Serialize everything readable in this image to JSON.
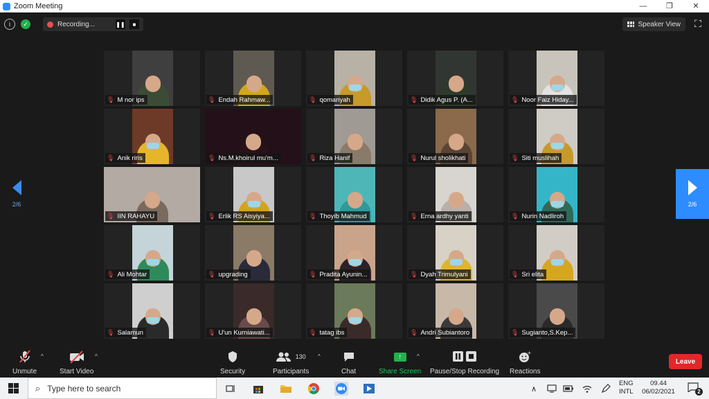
{
  "window": {
    "title": "Zoom Meeting",
    "minimize_glyph": "—",
    "restore_glyph": "❐",
    "close_glyph": "✕"
  },
  "topbar": {
    "info_glyph": "i",
    "shield_glyph": "✓",
    "recording_label": "Recording...",
    "pause_glyph": "❚❚",
    "stop_glyph": "■",
    "speaker_view_label": "Speaker View",
    "fullscreen_glyph": "⛶"
  },
  "pager": {
    "prev_label": "2/6",
    "next_label": "2/6"
  },
  "participants": [
    {
      "name": "M nor ips",
      "bg": "#3f3f3f",
      "shirt": "#3c4b36",
      "mask": false
    },
    {
      "name": "Endah Rahmaw...",
      "bg": "#5e5a52",
      "shirt": "#d4a71a",
      "mask": false
    },
    {
      "name": "qomariyah",
      "bg": "#b8b2a6",
      "shirt": "#c89a2a",
      "mask": true
    },
    {
      "name": "Didik Agus P. (A...",
      "bg": "#323632",
      "shirt": "#2e3b2b",
      "mask": false
    },
    {
      "name": "Noor Faiz Hiday...",
      "bg": "#c8c4bc",
      "shirt": "#e2e2e2",
      "mask": true
    },
    {
      "name": "Anik riris",
      "bg": "#6e3a28",
      "shirt": "#e5b62a",
      "mask": true
    },
    {
      "name": "Ns.M.khoirul mu'm...",
      "bg": "#241018",
      "shirt": "#2a1218",
      "mask": false
    },
    {
      "name": "Riza Hanif",
      "bg": "#a09a94",
      "shirt": "#8a7a6a",
      "mask": false
    },
    {
      "name": "Nurul sholikhati",
      "bg": "#8a6a4a",
      "shirt": "#5a4434",
      "mask": false
    },
    {
      "name": "Siti muslihah",
      "bg": "#cfcbc5",
      "shirt": "#c69a2a",
      "mask": true
    },
    {
      "name": "IIN RAHAYU",
      "bg": "#b4aaa4",
      "shirt": "#7a6a5e",
      "mask": false
    },
    {
      "name": "Erlik RS Aisyiya...",
      "bg": "#c8c8c8",
      "shirt": "#d4a31e",
      "mask": true
    },
    {
      "name": "Thoyib Mahmud",
      "bg": "#4fb6b8",
      "shirt": "#2e9a9a",
      "mask": false
    },
    {
      "name": "Erna ardhy yanti",
      "bg": "#d8d4d0",
      "shirt": "#b8b0aa",
      "mask": false
    },
    {
      "name": "Nurin Nadliroh",
      "bg": "#34b6c8",
      "shirt": "#2e6a5a",
      "mask": true
    },
    {
      "name": "Ali Mohtar",
      "bg": "#c4d4d8",
      "shirt": "#2e8a5a",
      "mask": true
    },
    {
      "name": "upgrading",
      "bg": "#8a7a66",
      "shirt": "#2a2a3a",
      "mask": false
    },
    {
      "name": "Pradita Ayunin...",
      "bg": "#caa48a",
      "shirt": "#2a2228",
      "mask": true
    },
    {
      "name": "Dyah Trimulyani",
      "bg": "#d8d2c6",
      "shirt": "#e0b52a",
      "mask": true
    },
    {
      "name": "Sri elita",
      "bg": "#d2ccc6",
      "shirt": "#d6a61e",
      "mask": true
    },
    {
      "name": "Salamun",
      "bg": "#cfcfcf",
      "shirt": "#2a2a2a",
      "mask": true
    },
    {
      "name": "U'un Kurniawati...",
      "bg": "#3a2a2a",
      "shirt": "#6a4a4a",
      "mask": false
    },
    {
      "name": "tatag ibs",
      "bg": "#6a7a5a",
      "shirt": "#3a2a2a",
      "mask": true
    },
    {
      "name": "Andri Subiantoro",
      "bg": "#c8b8a8",
      "shirt": "#3a3a3a",
      "mask": false
    },
    {
      "name": "Sugianto,S.Kep...",
      "bg": "#4a4a4a",
      "shirt": "#2a2a2a",
      "mask": false
    }
  ],
  "toolbar": {
    "unmute_label": "Unmute",
    "start_video_label": "Start Video",
    "security_label": "Security",
    "participants_label": "Participants",
    "participants_count": "130",
    "chat_label": "Chat",
    "share_label": "Share Screen",
    "share_glyph": "↑",
    "record_label": "Pause/Stop Recording",
    "reactions_label": "Reactions",
    "leave_label": "Leave",
    "caret_glyph": "^"
  },
  "taskbar": {
    "search_placeholder": "Type here to search",
    "lang_top": "ENG",
    "lang_bottom": "INTL",
    "time": "09.44",
    "date": "06/02/2021",
    "notif_count": "2",
    "up_glyph": "∧"
  },
  "colors": {
    "accent": "#2d8cff",
    "share_green": "#22b14c",
    "leave_red": "#e02828",
    "mute_red": "#e24a4a"
  }
}
